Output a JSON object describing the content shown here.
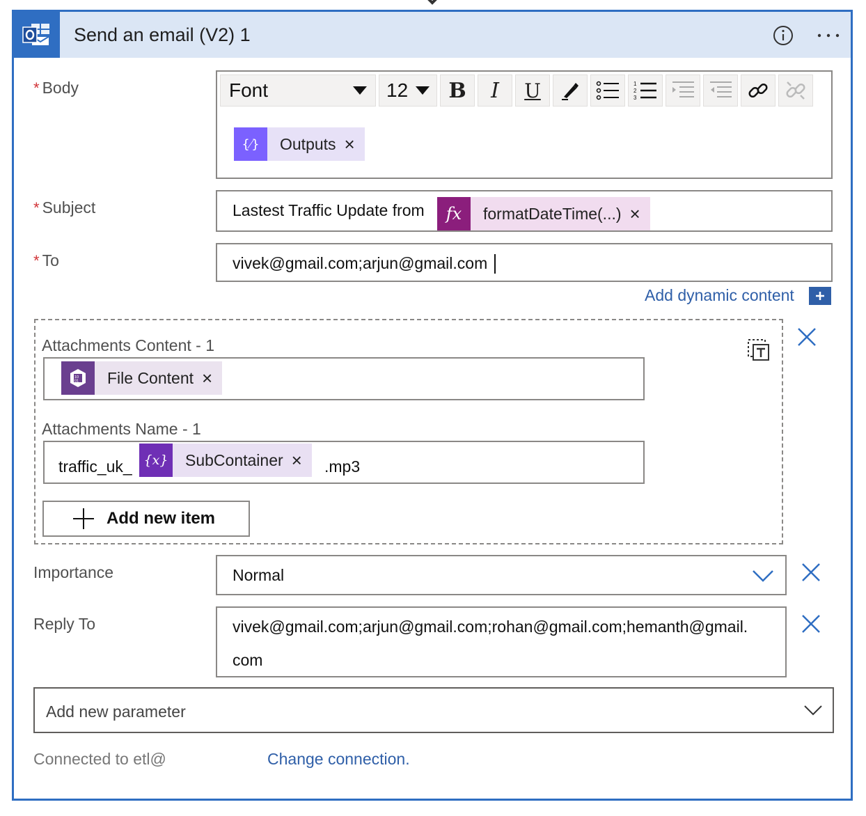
{
  "header": {
    "title": "Send an email (V2) 1"
  },
  "body_field": {
    "label": "Body",
    "required_marker": "*",
    "toolbar": {
      "font_label": "Font",
      "size_label": "12",
      "buttons": [
        "bold-icon",
        "italic-icon",
        "underline-icon",
        "highlight-pen-icon",
        "bullet-list-icon",
        "numbered-list-icon",
        "indent-icon",
        "outdent-icon",
        "link-icon",
        "unlink-icon"
      ]
    },
    "token": {
      "label": "Outputs",
      "remove": "×",
      "icon": "variable-braces-icon",
      "color": "#7b61ff"
    }
  },
  "subject_field": {
    "label": "Subject",
    "required_marker": "*",
    "text": "Lastest Traffic Update from",
    "token": {
      "label": "formatDateTime(...)",
      "remove": "×",
      "icon": "fx-icon",
      "color": "#8b1e7c"
    }
  },
  "to_field": {
    "label": "To",
    "required_marker": "*",
    "value": "vivek@gmail.com;arjun@gmail.com"
  },
  "add_dynamic_content": {
    "label": "Add dynamic content",
    "icon": "plus-box-icon"
  },
  "attachments": {
    "content_label": "Attachments Content - 1",
    "content_token": {
      "label": "File Content",
      "remove": "×",
      "icon": "blob-storage-icon",
      "color": "#6a3f8f"
    },
    "name_label": "Attachments Name - 1",
    "name_prefix": "traffic_uk_",
    "name_token": {
      "label": "SubContainer",
      "remove": "×",
      "icon": "variable-braces-icon",
      "color": "#6f2fb5"
    },
    "name_suffix": ".mp3",
    "add_item_label": "Add new item"
  },
  "importance_field": {
    "label": "Importance",
    "value": "Normal"
  },
  "reply_to_field": {
    "label": "Reply To",
    "value_line1": "vivek@gmail.com;arjun@gmail.com;rohan@gmail.com;hemanth@gmail.",
    "value_line2": "com"
  },
  "add_parameter": {
    "label": "Add new parameter"
  },
  "footer": {
    "connected_label": "Connected to etl@",
    "change_connection": "Change connection."
  },
  "colors": {
    "accent": "#2f6ec2",
    "header_bg": "#dbe6f5",
    "link": "#2f5fa8",
    "required": "#d13438"
  }
}
